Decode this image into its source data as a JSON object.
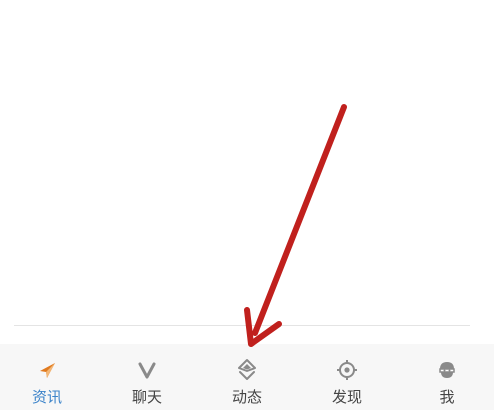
{
  "colors": {
    "active_label": "#3b83c9",
    "inactive_label": "#444444",
    "tabbar_bg": "#f7f7f7",
    "annotation_arrow": "#c0201d",
    "news_icon": "#e07a1f",
    "inactive_icon": "#8a8a8a"
  },
  "tabbar": {
    "active_tab": "news",
    "tabs": [
      {
        "id": "news",
        "label": "资讯",
        "icon": "paper-plane-icon"
      },
      {
        "id": "chat",
        "label": "聊天",
        "icon": "v-logo-icon"
      },
      {
        "id": "moments",
        "label": "动态",
        "icon": "diamond-layers-icon"
      },
      {
        "id": "discover",
        "label": "发现",
        "icon": "target-icon"
      },
      {
        "id": "me",
        "label": "我",
        "icon": "user-avatar-icon"
      }
    ]
  }
}
